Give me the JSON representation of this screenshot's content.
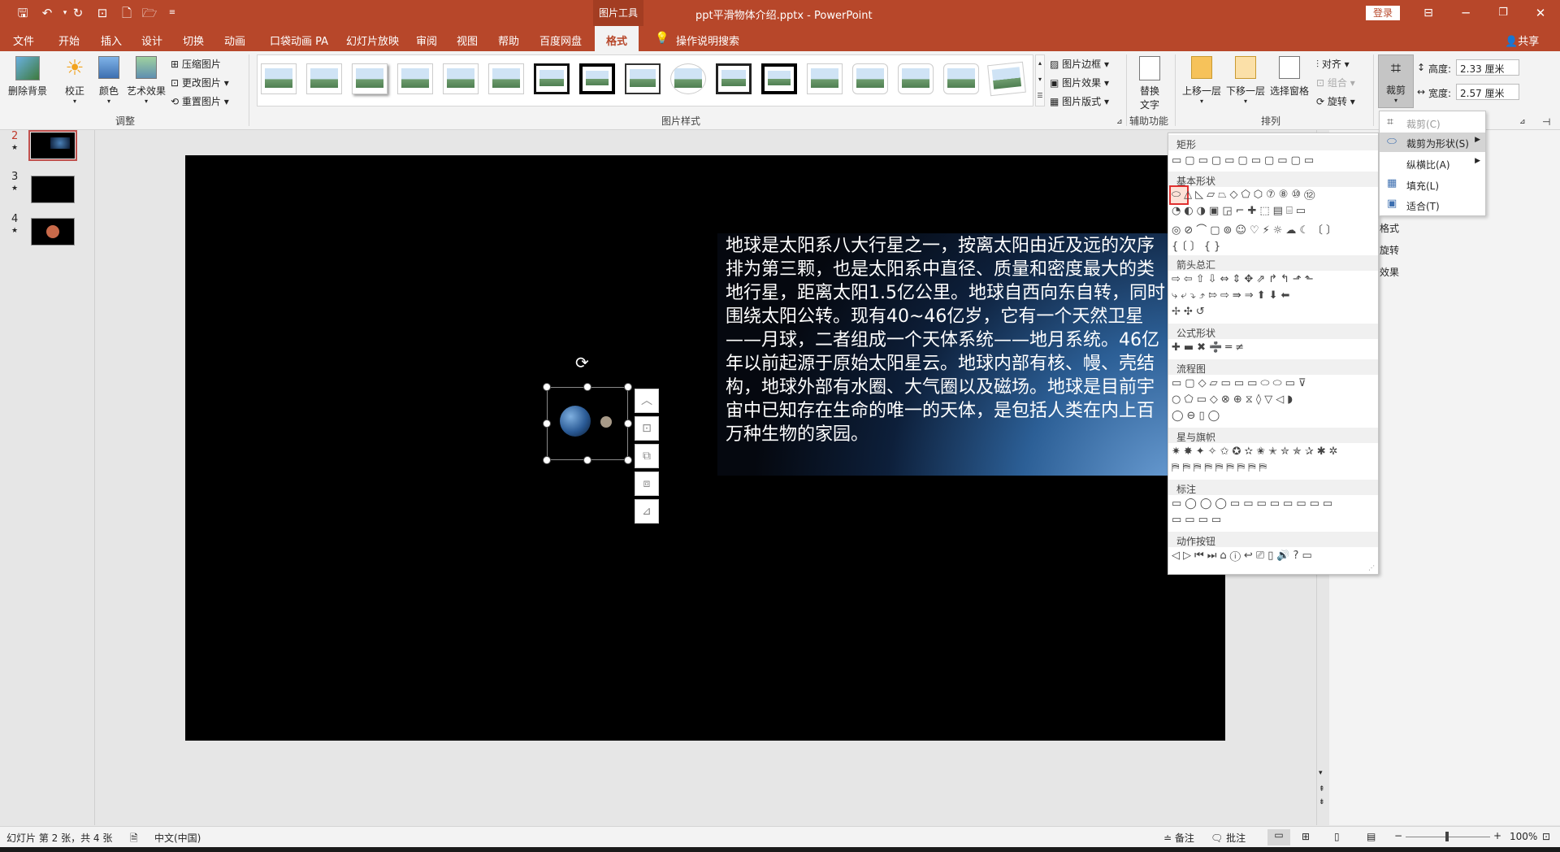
{
  "app": {
    "doc_title": "ppt平滑物体介绍.pptx",
    "separator": "-",
    "app_name": "PowerPoint",
    "context_tab_group": "图片工具",
    "login": "登录"
  },
  "tabs": [
    "文件",
    "开始",
    "插入",
    "设计",
    "切换",
    "动画",
    "口袋动画 PA",
    "幻灯片放映",
    "审阅",
    "视图",
    "帮助",
    "百度网盘",
    "格式"
  ],
  "tell_me": "操作说明搜索",
  "share": "共享",
  "ribbon": {
    "adjust": {
      "remove_bg": "删除背景",
      "correct": "校正",
      "color": "颜色",
      "art_effect": "艺术效果",
      "compress": "压缩图片",
      "change": "更改图片",
      "reset": "重置图片",
      "label": "调整"
    },
    "styles": {
      "label": "图片样式",
      "border": "图片边框",
      "effect": "图片效果",
      "layout": "图片版式"
    },
    "accessibility": {
      "alt_text_1": "替换",
      "alt_text_2": "文字",
      "label": "辅助功能"
    },
    "arrange": {
      "forward": "上移一层",
      "backward": "下移一层",
      "selection_pane": "选择窗格",
      "align": "对齐",
      "group": "组合",
      "rotate": "旋转",
      "label": "排列"
    },
    "size": {
      "crop": "裁剪",
      "height_label": "高度:",
      "height_value": "2.33 厘米",
      "width_label": "宽度:",
      "width_value": "2.57 厘米"
    }
  },
  "slides": [
    {
      "num": "2",
      "star": "★"
    },
    {
      "num": "3",
      "star": "★"
    },
    {
      "num": "4",
      "star": "★"
    }
  ],
  "slide_text": "地球是太阳系八大行星之一，按离太阳由近及远的次序排为第三颗，也是太阳系中直径、质量和密度最大的类地行星，距离太阳1.5亿公里。地球自西向东自转，同时围绕太阳公转。现有40~46亿岁，它有一个天然卫星——月球，二者组成一个天体系统——地月系统。46亿年以前起源于原始太阳星云。地球内部有核、幔、壳结构，地球外部有水圈、大气圈以及磁场。地球是目前宇宙中已知存在生命的唯一的天体，是包括人类在内上百万种生物的家园。",
  "shapes_panel": {
    "categories": [
      "矩形",
      "基本形状",
      "箭头总汇",
      "公式形状",
      "流程图",
      "星与旗帜",
      "标注",
      "动作按钮"
    ],
    "rows": {
      "rect": [
        "▭▢▭▢▭▢▭▢▭▢▭"
      ],
      "basic": [
        "⬭△◺▱⏢◇⬠⬡⑦⑧⑩⑫",
        "◔◐◑▣◲⌐✚⬚▤⌸▭",
        "◎⊘⌒▢⊚☺♡⚡☼☁☾〔〕",
        "{〔〕{}"
      ],
      "arrows": [
        "⇨⇦⇧⇩⇔⇕✥⇗↱↰⬏⬑",
        "⤷⤶⤵⤴⇰⇨⇛⇒⬆⬇⬅",
        "✢✣↺"
      ],
      "formula": [
        "✚▬✖➗═≠"
      ],
      "flow": [
        "▭▢◇▱▭▭▭⬭⬭▭⊽",
        "○⬠▭◇⊗⊕⧖◊▽◁◗",
        "◯⊖▯◯"
      ],
      "stars": [
        "✷✸✦✧✩✪✫✬✭✮✯✰✱✲",
        "⛿⛿⛿⛿⛿⛿⛿⛿⛿"
      ],
      "callouts": [
        "▭◯◯◯▭▭▭▭▭▭▭▭",
        "▭▭▭▭"
      ],
      "action": [
        "◁▷⏮⏭⌂ⓘ↩⎚▯🔊?▭"
      ]
    }
  },
  "crop_menu": {
    "crop": "裁剪(C)",
    "crop_to_shape": "裁剪为形状(S)",
    "aspect": "纵横比(A)",
    "fill": "填充(L)",
    "fit": "适合(T)"
  },
  "behind_labels": [
    "格式",
    "旋转",
    "效果"
  ],
  "status": {
    "slide_info": "幻灯片 第 2 张，共 4 张",
    "language": "中文(中国)",
    "notes": "备注",
    "comments": "批注",
    "zoom": "100%",
    "minus": "−",
    "plus": "+"
  }
}
